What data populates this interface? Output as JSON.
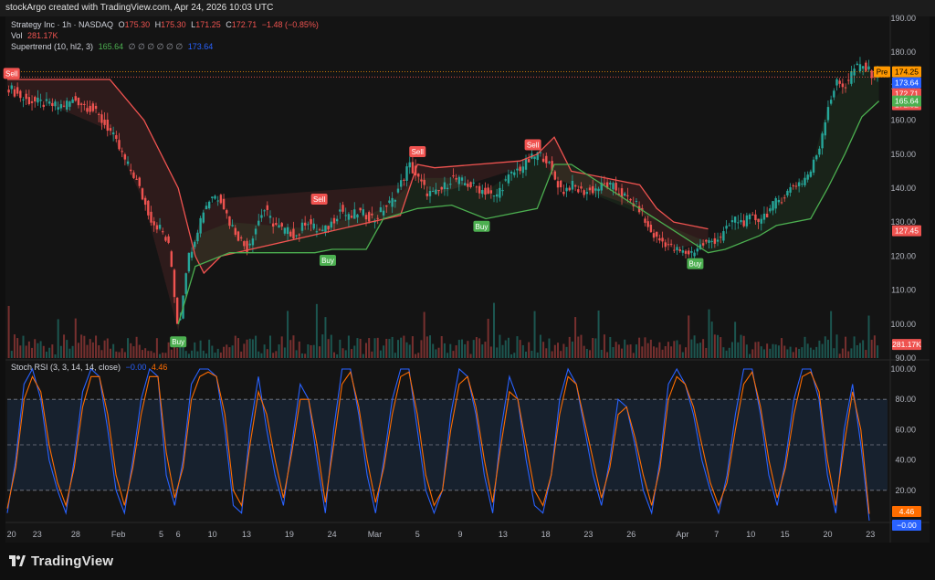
{
  "header": {
    "text": "stockArgo created with TradingView.com, Apr 24, 2026 10:03 UTC"
  },
  "legend": {
    "symbol": "Strategy Inc · 1h · NASDAQ",
    "o_label": "O",
    "o": "175.30",
    "h_label": "H",
    "h": "175.30",
    "l_label": "L",
    "l": "171.25",
    "c_label": "C",
    "c": "172.71",
    "change": "−1.48 (−0.85%)",
    "vol_label": "Vol",
    "vol": "281.17K",
    "st_label": "Supertrend (10, hl2, 3)",
    "st_up": "165.64",
    "st_ph": "∅ ∅ ∅ ∅ ∅ ∅",
    "st_down": "173.64",
    "rsi_label": "Stoch RSI (3, 3, 14, 14, close)",
    "rsi_k": "−0.00",
    "rsi_d": "4.46"
  },
  "footer": {
    "brand": "TradingView"
  },
  "colors": {
    "up": "#26a69a",
    "down": "#ef5350",
    "bg": "#141414",
    "st_up": "#4caf50",
    "st_down": "#f05350",
    "k": "#2962ff",
    "d": "#ff6d00",
    "pre": "#ff9800"
  },
  "price_labels": {
    "pre_tag": "Pre",
    "pre": "174.25",
    "st_down": "173.64",
    "last": "172.71",
    "st_line": "172.52",
    "st_up": "165.64",
    "red_box": "127.45",
    "vol": "281.17K",
    "rsi_d": "4.46",
    "rsi_k": "−0.00"
  },
  "chart_data": [
    {
      "type": "candlestick",
      "title": "Strategy Inc · 1h · NASDAQ",
      "ylim": [
        90,
        190
      ],
      "y_ticks": [
        90,
        100,
        110,
        120,
        130,
        140,
        150,
        160,
        170,
        180,
        190
      ],
      "x_tick_labels": [
        "20",
        "23",
        "28",
        "Feb",
        "5",
        "6",
        "10",
        "13",
        "19",
        "24",
        "Mar",
        "5",
        "9",
        "13",
        "18",
        "23",
        "26",
        "Apr",
        "7",
        "10",
        "15",
        "20",
        "23"
      ],
      "x_tick_positions": [
        0.5,
        3.5,
        8,
        13,
        18,
        20,
        24,
        28,
        33,
        38,
        43,
        48,
        53,
        58,
        63,
        68,
        73,
        79,
        83,
        87,
        91,
        96,
        101
      ],
      "x_range": [
        0,
        103
      ],
      "close_path": [
        [
          0,
          170
        ],
        [
          2,
          166
        ],
        [
          4,
          165
        ],
        [
          6,
          164
        ],
        [
          8,
          166
        ],
        [
          10,
          163
        ],
        [
          11,
          160
        ],
        [
          12,
          157
        ],
        [
          13,
          152
        ],
        [
          14,
          147
        ],
        [
          15,
          143
        ],
        [
          16,
          136
        ],
        [
          17,
          130
        ],
        [
          18,
          128
        ],
        [
          19,
          122
        ],
        [
          20,
          98
        ],
        [
          21,
          118
        ],
        [
          22,
          126
        ],
        [
          23,
          134
        ],
        [
          24,
          138
        ],
        [
          25,
          137
        ],
        [
          26,
          130
        ],
        [
          27,
          126
        ],
        [
          28,
          122
        ],
        [
          29,
          128
        ],
        [
          30,
          134
        ],
        [
          31,
          130
        ],
        [
          32,
          128
        ],
        [
          33,
          127
        ],
        [
          34,
          126
        ],
        [
          35,
          131
        ],
        [
          36,
          128
        ],
        [
          37,
          127
        ],
        [
          38,
          130
        ],
        [
          39,
          134
        ],
        [
          40,
          131
        ],
        [
          41,
          133
        ],
        [
          42,
          132
        ],
        [
          43,
          131
        ],
        [
          44,
          134
        ],
        [
          45,
          136
        ],
        [
          46,
          141
        ],
        [
          47,
          147
        ],
        [
          48,
          143
        ],
        [
          49,
          139
        ],
        [
          50,
          138
        ],
        [
          51,
          140
        ],
        [
          52,
          143
        ],
        [
          53,
          142
        ],
        [
          54,
          141
        ],
        [
          55,
          140
        ],
        [
          56,
          139
        ],
        [
          57,
          137
        ],
        [
          58,
          141
        ],
        [
          59,
          144
        ],
        [
          60,
          146
        ],
        [
          61,
          148
        ],
        [
          62,
          150
        ],
        [
          63,
          149
        ],
        [
          64,
          143
        ],
        [
          65,
          139
        ],
        [
          66,
          141
        ],
        [
          67,
          139
        ],
        [
          68,
          139
        ],
        [
          69,
          140
        ],
        [
          70,
          141
        ],
        [
          71,
          140
        ],
        [
          72,
          138
        ],
        [
          73,
          136
        ],
        [
          74,
          134
        ],
        [
          75,
          128
        ],
        [
          76,
          125
        ],
        [
          77,
          124
        ],
        [
          78,
          122
        ],
        [
          79,
          121
        ],
        [
          80,
          121
        ],
        [
          81,
          123
        ],
        [
          82,
          124
        ],
        [
          83,
          125
        ],
        [
          84,
          127
        ],
        [
          85,
          131
        ],
        [
          86,
          130
        ],
        [
          87,
          131
        ],
        [
          88,
          131
        ],
        [
          89,
          133
        ],
        [
          90,
          136
        ],
        [
          91,
          138
        ],
        [
          92,
          141
        ],
        [
          93,
          142
        ],
        [
          94,
          145
        ],
        [
          95,
          152
        ],
        [
          96,
          164
        ],
        [
          97,
          171
        ],
        [
          98,
          170
        ],
        [
          99,
          175
        ],
        [
          100,
          176
        ],
        [
          101,
          174
        ],
        [
          102,
          172.71
        ]
      ],
      "supertrend_down": [
        [
          0,
          172
        ],
        [
          12,
          172
        ],
        [
          16,
          160
        ],
        [
          20,
          140
        ],
        [
          22,
          120
        ],
        [
          23,
          115
        ],
        [
          25,
          120
        ],
        [
          46,
          132
        ],
        [
          48,
          147
        ],
        [
          50,
          146
        ],
        [
          60,
          148
        ],
        [
          62,
          150
        ],
        [
          64,
          155
        ],
        [
          66,
          145
        ],
        [
          74,
          141
        ],
        [
          76,
          134
        ],
        [
          78,
          130
        ],
        [
          82,
          128
        ]
      ],
      "supertrend_up": [
        [
          20,
          100
        ],
        [
          22,
          117
        ],
        [
          26,
          121
        ],
        [
          36,
          121
        ],
        [
          38,
          122
        ],
        [
          42,
          122
        ],
        [
          44,
          131
        ],
        [
          48,
          134
        ],
        [
          52,
          135
        ],
        [
          56,
          131
        ],
        [
          62,
          134
        ],
        [
          64,
          147
        ],
        [
          66,
          147
        ],
        [
          82,
          121
        ],
        [
          84,
          122
        ],
        [
          88,
          126
        ],
        [
          90,
          129
        ],
        [
          94,
          131
        ],
        [
          96,
          140
        ],
        [
          98,
          150
        ],
        [
          100,
          161
        ],
        [
          102,
          165.64
        ]
      ],
      "signals": [
        {
          "label": "Sell",
          "x": 0.5,
          "y": 170
        },
        {
          "label": "Buy",
          "x": 20,
          "y": 98
        },
        {
          "label": "Sell",
          "x": 36.5,
          "y": 133
        },
        {
          "label": "Buy",
          "x": 37.5,
          "y": 122
        },
        {
          "label": "Sell",
          "x": 48,
          "y": 147
        },
        {
          "label": "Buy",
          "x": 55.5,
          "y": 132
        },
        {
          "label": "Sell",
          "x": 61.5,
          "y": 149
        },
        {
          "label": "Buy",
          "x": 80.5,
          "y": 121
        }
      ],
      "volume_label": "281.17K"
    },
    {
      "type": "line",
      "title": "Stoch RSI (3, 3, 14, 14, close)",
      "ylim": [
        0,
        100
      ],
      "y_ticks": [
        20,
        40,
        60,
        80,
        100
      ],
      "bands": [
        20,
        50,
        80
      ],
      "series": [
        {
          "name": "K",
          "values": [
            5,
            40,
            90,
            100,
            80,
            40,
            20,
            5,
            40,
            85,
            100,
            95,
            60,
            20,
            5,
            40,
            80,
            100,
            95,
            30,
            10,
            40,
            90,
            100,
            100,
            95,
            60,
            10,
            5,
            60,
            95,
            60,
            30,
            10,
            50,
            90,
            80,
            40,
            5,
            60,
            100,
            100,
            70,
            30,
            5,
            40,
            80,
            100,
            100,
            60,
            20,
            5,
            20,
            70,
            100,
            95,
            70,
            30,
            5,
            60,
            95,
            80,
            40,
            10,
            5,
            30,
            80,
            100,
            90,
            60,
            30,
            10,
            40,
            80,
            75,
            50,
            20,
            5,
            40,
            90,
            100,
            90,
            70,
            40,
            20,
            5,
            30,
            70,
            100,
            100,
            70,
            30,
            10,
            40,
            80,
            100,
            100,
            80,
            30,
            5,
            60,
            90,
            50,
            0
          ]
        },
        {
          "name": "D",
          "values": [
            8,
            35,
            80,
            95,
            85,
            50,
            25,
            10,
            35,
            75,
            95,
            95,
            70,
            30,
            10,
            35,
            70,
            95,
            95,
            45,
            15,
            35,
            80,
            95,
            98,
            95,
            70,
            20,
            10,
            50,
            85,
            70,
            40,
            15,
            45,
            80,
            80,
            50,
            12,
            50,
            90,
            98,
            75,
            40,
            12,
            35,
            70,
            95,
            98,
            70,
            30,
            10,
            20,
            60,
            90,
            95,
            75,
            40,
            12,
            50,
            85,
            80,
            50,
            20,
            10,
            30,
            70,
            95,
            90,
            65,
            40,
            15,
            35,
            70,
            75,
            55,
            30,
            10,
            35,
            80,
            95,
            90,
            75,
            50,
            25,
            10,
            25,
            60,
            90,
            98,
            75,
            40,
            15,
            35,
            70,
            95,
            98,
            85,
            40,
            10,
            50,
            85,
            60,
            4.46
          ]
        }
      ]
    }
  ]
}
